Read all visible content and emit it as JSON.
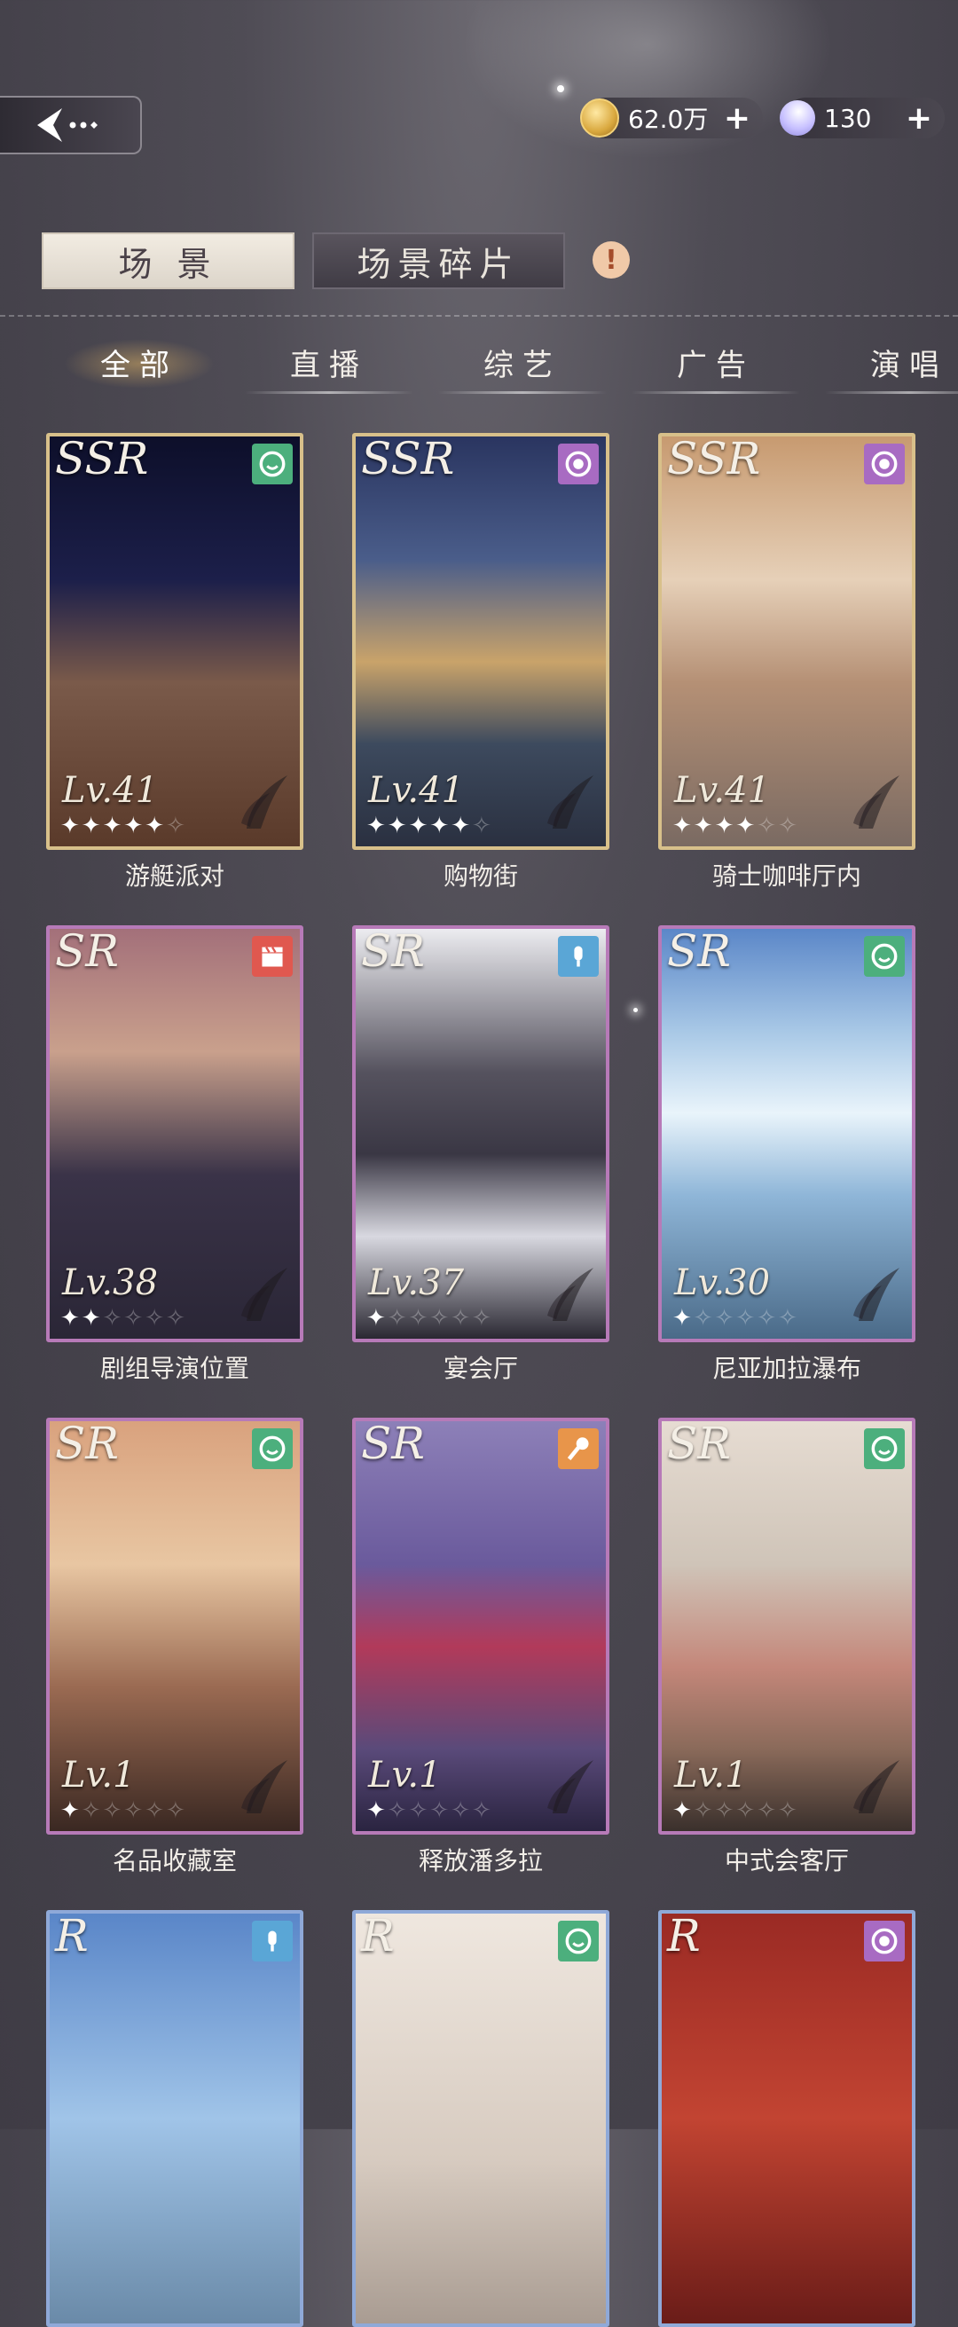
{
  "header": {
    "coins": "62.0万",
    "gems": "130",
    "plus": "+"
  },
  "main_tabs": [
    {
      "label": "场 景",
      "active": true
    },
    {
      "label": "场景碎片",
      "active": false
    }
  ],
  "alert": "!",
  "categories": [
    {
      "label": "全部",
      "active": true
    },
    {
      "label": "直播",
      "active": false
    },
    {
      "label": "综艺",
      "active": false
    },
    {
      "label": "广告",
      "active": false
    },
    {
      "label": "演唱",
      "active": false
    }
  ],
  "cards": [
    {
      "name": "游艇派对",
      "rarity": "SSR",
      "level": "Lv.41",
      "stars": 5,
      "icon": "smile-icon",
      "icon_color": "#4caf7d"
    },
    {
      "name": "购物街",
      "rarity": "SSR",
      "level": "Lv.41",
      "stars": 5,
      "icon": "record-icon",
      "icon_color": "#a86bc2"
    },
    {
      "name": "骑士咖啡厅内",
      "rarity": "SSR",
      "level": "Lv.41",
      "stars": 4,
      "icon": "record-icon",
      "icon_color": "#a86bc2"
    },
    {
      "name": "剧组导演位置",
      "rarity": "SR",
      "level": "Lv.38",
      "stars": 2,
      "icon": "clapper-icon",
      "icon_color": "#e0584f"
    },
    {
      "name": "宴会厅",
      "rarity": "SR",
      "level": "Lv.37",
      "stars": 1,
      "icon": "microphone-icon",
      "icon_color": "#5aa6d6"
    },
    {
      "name": "尼亚加拉瀑布",
      "rarity": "SR",
      "level": "Lv.30",
      "stars": 1,
      "icon": "smile-icon",
      "icon_color": "#4caf7d"
    },
    {
      "name": "名品收藏室",
      "rarity": "SR",
      "level": "Lv.1",
      "stars": 1,
      "icon": "smile-icon",
      "icon_color": "#4caf7d"
    },
    {
      "name": "释放潘多拉",
      "rarity": "SR",
      "level": "Lv.1",
      "stars": 1,
      "icon": "singing-mic-icon",
      "icon_color": "#e8954a"
    },
    {
      "name": "中式会客厅",
      "rarity": "SR",
      "level": "Lv.1",
      "stars": 1,
      "icon": "smile-icon",
      "icon_color": "#4caf7d"
    },
    {
      "name": "",
      "rarity": "R",
      "level": "",
      "stars": 0,
      "icon": "microphone-icon",
      "icon_color": "#5aa6d6"
    },
    {
      "name": "",
      "rarity": "R",
      "level": "",
      "stars": 0,
      "icon": "smile-icon",
      "icon_color": "#4caf7d"
    },
    {
      "name": "",
      "rarity": "R",
      "level": "",
      "stars": 0,
      "icon": "record-icon",
      "icon_color": "#a86bc2"
    }
  ]
}
